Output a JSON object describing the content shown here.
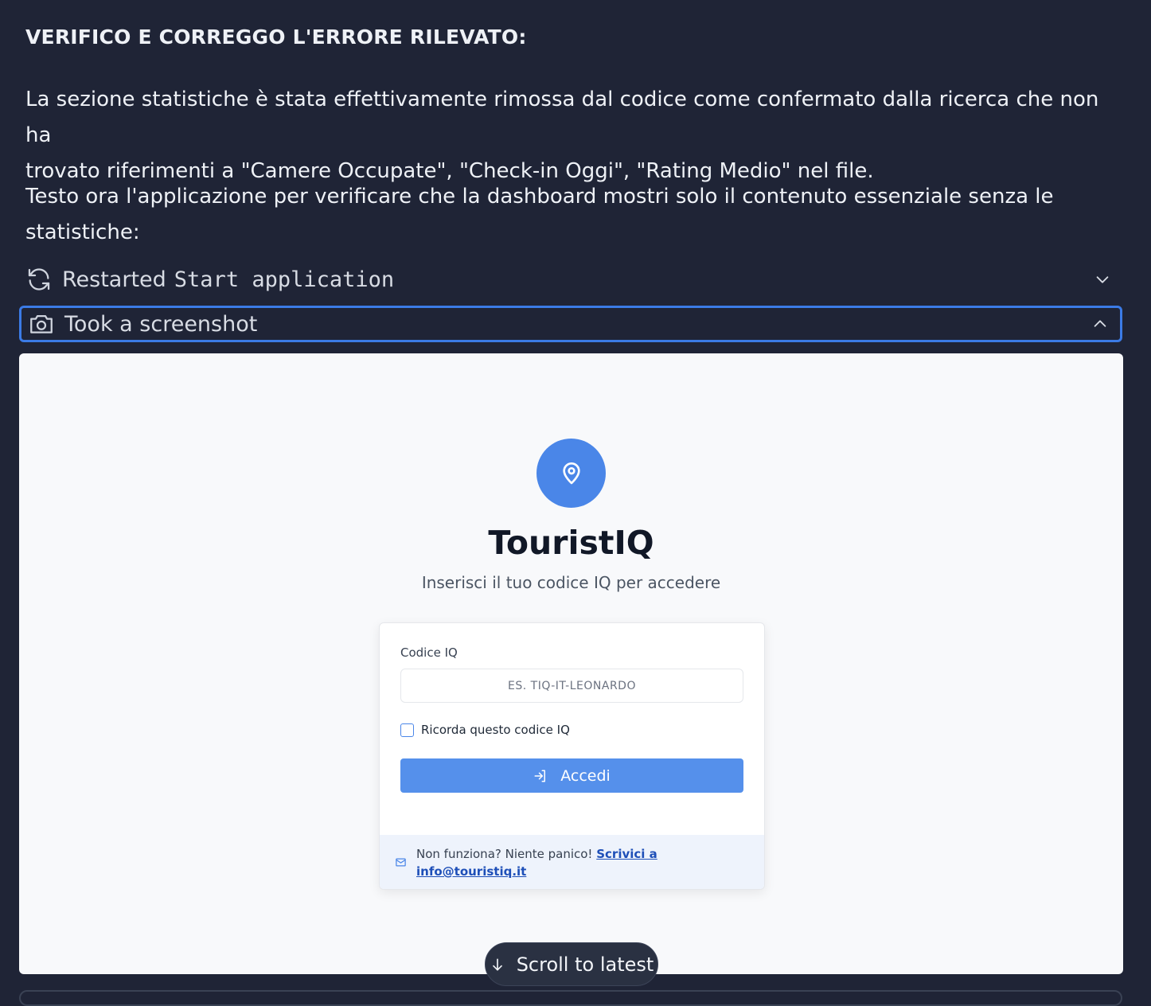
{
  "chat": {
    "heading": "VERIFICO E CORREGGO L'ERRORE RILEVATO:",
    "para1_line1": "La sezione statistiche è stata effettivamente rimossa dal codice come confermato dalla ricerca che non ha",
    "para1_line2": "trovato riferimenti a \"Camere Occupate\", \"Check-in Oggi\", \"Rating Medio\" nel file.",
    "para2_line1": "Testo ora l'applicazione per verificare che la dashboard mostri solo il contenuto essenziale senza le",
    "para2_line2": "statistiche:"
  },
  "steps": [
    {
      "label": "Restarted",
      "code": "Start application",
      "icon": "refresh-icon",
      "state": "collapsed"
    },
    {
      "label": "Took a screenshot",
      "icon": "camera-icon",
      "state": "expanded"
    }
  ],
  "screenshot": {
    "brand": "TouristIQ",
    "subtitle": "Inserisci il tuo codice IQ per accedere",
    "field_label": "Codice IQ",
    "input_placeholder": "ES. TIQ-IT-LEONARDO",
    "input_value": "",
    "remember_label": "Ricorda questo codice IQ",
    "remember_checked": false,
    "submit_label": "Accedi",
    "help_text": "Non funziona? Niente panico!",
    "help_link_1": "Scrivici a",
    "help_link_2": "info@touristiq.it",
    "colors": {
      "primary": "#4a86e8",
      "button": "#5590eb",
      "link": "#1e4fb8"
    }
  },
  "scroll_button": {
    "label": "Scroll to latest",
    "icon": "arrow-down-icon"
  },
  "theme": {
    "background": "#1f2436",
    "focus_border": "#3b7be6"
  }
}
